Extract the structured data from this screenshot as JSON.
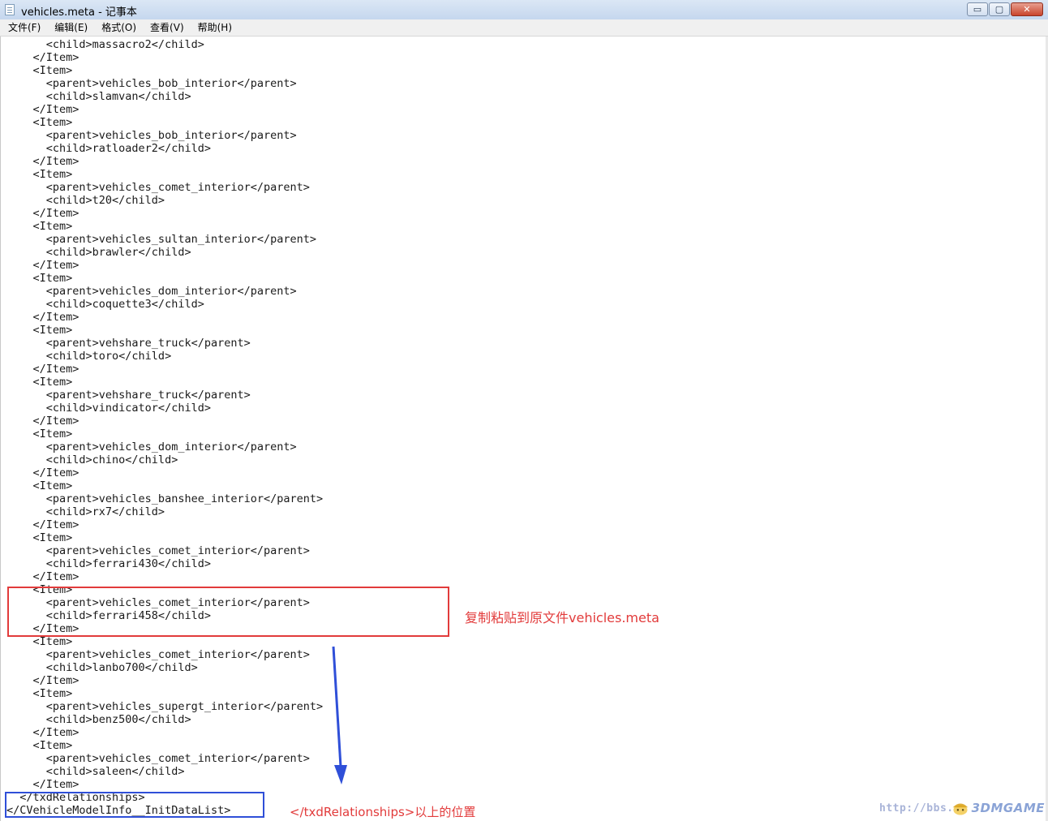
{
  "window": {
    "title": "vehicles.meta - 记事本",
    "buttons": {
      "minimize": "▭",
      "maximize": "▢",
      "close": "✕"
    }
  },
  "menu": [
    "文件(F)",
    "编辑(E)",
    "格式(O)",
    "查看(V)",
    "帮助(H)"
  ],
  "editor": {
    "lines": [
      "      <child>massacro2</child>",
      "    </Item>",
      "    <Item>",
      "      <parent>vehicles_bob_interior</parent>",
      "      <child>slamvan</child>",
      "    </Item>",
      "    <Item>",
      "      <parent>vehicles_bob_interior</parent>",
      "      <child>ratloader2</child>",
      "    </Item>",
      "    <Item>",
      "      <parent>vehicles_comet_interior</parent>",
      "      <child>t20</child>",
      "    </Item>",
      "    <Item>",
      "      <parent>vehicles_sultan_interior</parent>",
      "      <child>brawler</child>",
      "    </Item>",
      "    <Item>",
      "      <parent>vehicles_dom_interior</parent>",
      "      <child>coquette3</child>",
      "    </Item>",
      "    <Item>",
      "      <parent>vehshare_truck</parent>",
      "      <child>toro</child>",
      "    </Item>",
      "    <Item>",
      "      <parent>vehshare_truck</parent>",
      "      <child>vindicator</child>",
      "    </Item>",
      "    <Item>",
      "      <parent>vehicles_dom_interior</parent>",
      "      <child>chino</child>",
      "    </Item>",
      "    <Item>",
      "      <parent>vehicles_banshee_interior</parent>",
      "      <child>rx7</child>",
      "    </Item>",
      "    <Item>",
      "      <parent>vehicles_comet_interior</parent>",
      "      <child>ferrari430</child>",
      "    </Item>",
      "    <Item>",
      "      <parent>vehicles_comet_interior</parent>",
      "      <child>ferrari458</child>",
      "    </Item>",
      "    <Item>",
      "      <parent>vehicles_comet_interior</parent>",
      "      <child>lanbo700</child>",
      "    </Item>",
      "    <Item>",
      "      <parent>vehicles_supergt_interior</parent>",
      "      <child>benz500</child>",
      "    </Item>",
      "    <Item>",
      "      <parent>vehicles_comet_interior</parent>",
      "      <child>saleen</child>",
      "    </Item>",
      "  </txdRelationships>",
      "</CVehicleModelInfo__InitDataList>"
    ]
  },
  "annotations": {
    "copy_note": "复制粘贴到原文件vehicles.meta",
    "position_note": "</txdRelationships>以上的位置",
    "red_color": "#e23b3b",
    "blue_color": "#2f4fd8"
  },
  "watermark": {
    "url": "http://bbs.",
    "brand": "3DMGAME"
  }
}
